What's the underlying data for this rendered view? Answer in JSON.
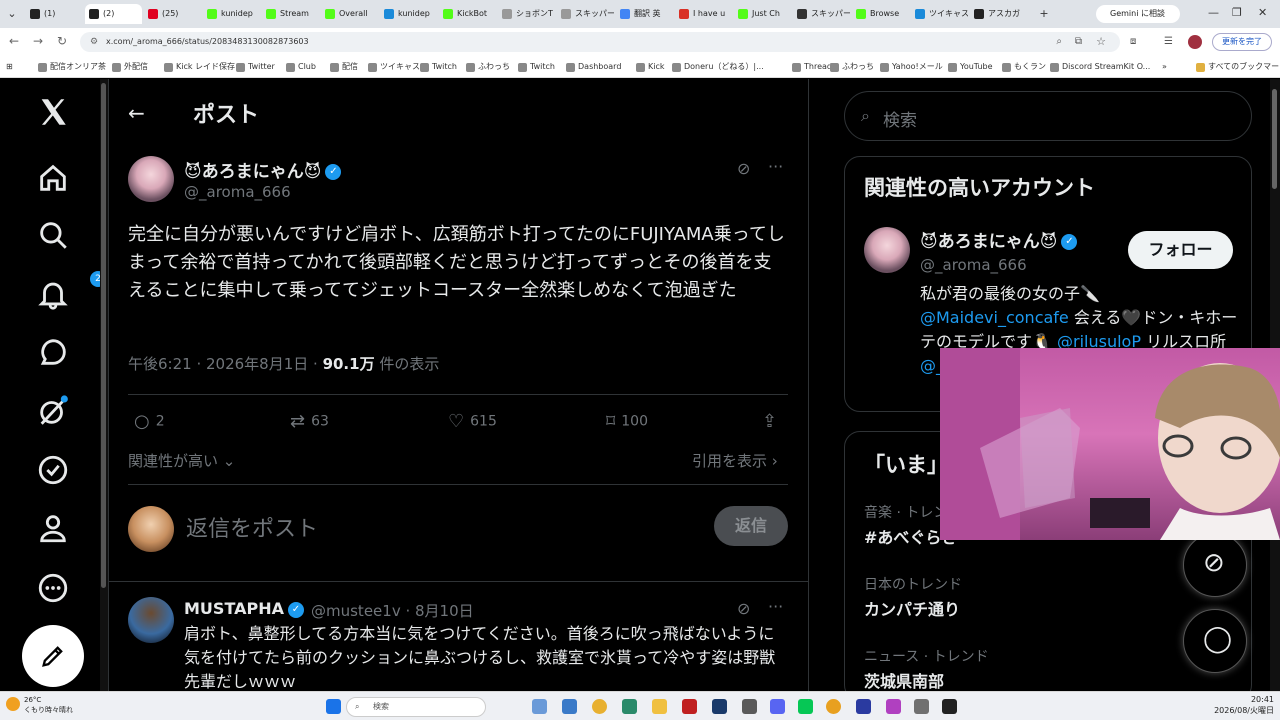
{
  "browser": {
    "tabs": [
      {
        "label": "(1)",
        "color": "#222222"
      },
      {
        "label": "(2)",
        "color": "#222222"
      },
      {
        "label": "(25)",
        "color": "#e00020"
      },
      {
        "label": "kunidep",
        "color": "#53fc18"
      },
      {
        "label": "Stream",
        "color": "#53fc18"
      },
      {
        "label": "Overall",
        "color": "#53fc18"
      },
      {
        "label": "kunidep",
        "color": "#1a8ad9"
      },
      {
        "label": "KickBot",
        "color": "#53fc18"
      },
      {
        "label": "ショボンT",
        "color": "#999999"
      },
      {
        "label": "スキッパー",
        "color": "#999999"
      },
      {
        "label": "翻訳 英",
        "color": "#4285f4"
      },
      {
        "label": "I have u",
        "color": "#d93025"
      },
      {
        "label": "Just Ch",
        "color": "#53fc18"
      },
      {
        "label": "スキッパー",
        "color": "#333333"
      },
      {
        "label": "Browse",
        "color": "#53fc18"
      },
      {
        "label": "ツイキャス",
        "color": "#1a8ad9"
      },
      {
        "label": "アスカガ",
        "color": "#222222"
      }
    ],
    "new_tab": "+",
    "gemini": "Gemini に相談",
    "url": "x.com/_aroma_666/status/2083483130082873603",
    "update_label": "更新を完了",
    "bookmarks": [
      "配信オンリア茶",
      "外配信",
      "Kick レイド保存",
      "Twitter",
      "Club",
      "配信",
      "ツイキャス",
      "Twitch",
      "ふわっち",
      "Twitch",
      "Dashboard",
      "Kick",
      "Doneru（どねる）|...",
      "Threads",
      "ふわっち",
      "Yahoo!メール",
      "YouTube",
      "もくラン",
      "Discord StreamKit O..."
    ],
    "all_bookmarks": "すべてのブックマーク"
  },
  "left_nav": {
    "notification_count": "2"
  },
  "post": {
    "header_title": "ポスト",
    "author_name": "😈あろまにゃん😈",
    "author_handle": "@_aroma_666",
    "text": "完全に自分が悪いんですけど肩ボト、広頚筋ボト打ってたのにFUJIYAMA乗ってしまって余裕で首持ってかれて後頭部軽くだと思うけど打ってずっとその後首を支えることに集中して乗っててジェットコースター全然楽しめなくて泡過ぎた",
    "time": "午後6:21 · 2026年8月1日 · ",
    "views": "90.1万",
    "views_label": " 件の表示",
    "replies": "2",
    "reposts": "63",
    "likes": "615",
    "bookmarks": "100",
    "sort_label": "関連性が高い",
    "quotes_label": "引用を表示",
    "reply_placeholder": "返信をポスト",
    "reply_button": "返信"
  },
  "reply": {
    "name": "MUSTAPHA",
    "handle": "@mustee1v · 8月10日",
    "text": "肩ボト、鼻整形してる方本当に気をつけてください。首後ろに吹っ飛ばないように気を付けてたら前のクッションに鼻ぶつけるし、救護室で氷貰って冷やす姿は野獣先輩だしｗｗｗ"
  },
  "sidebar": {
    "search_placeholder": "検索",
    "related_title": "関連性の高いアカウント",
    "acct_name": "😈あろまにゃん😈",
    "acct_handle": "@_aroma_666",
    "follow": "フォロー",
    "bio_1": "私が君の最後の女の子🔪",
    "bio_link1": "@Maidevi_concafe",
    "bio_2": " 会える🖤ドン・キホーテのモデルです🐧 ",
    "bio_link2": "@rilusuloP",
    "bio_3": " リルスロ所",
    "bio_link3": "@_",
    "trends_title": "「いま」",
    "trends": [
      {
        "category": "音楽 · トレンド",
        "name": "#あべぐらさ"
      },
      {
        "category": "日本のトレンド",
        "name": "カンパチ通り"
      },
      {
        "category": "ニュース · トレンド",
        "name": "茨城県南部"
      }
    ]
  },
  "taskbar": {
    "weather_temp": "26°C",
    "weather_desc": "くもり時々晴れ",
    "search_label": "検索",
    "time": "20:41",
    "date": "2026/08/火曜日"
  },
  "colors": {
    "accent": "#1d9bf0",
    "bg": "#000000",
    "text": "#e7e9ea",
    "muted": "#71767b"
  }
}
